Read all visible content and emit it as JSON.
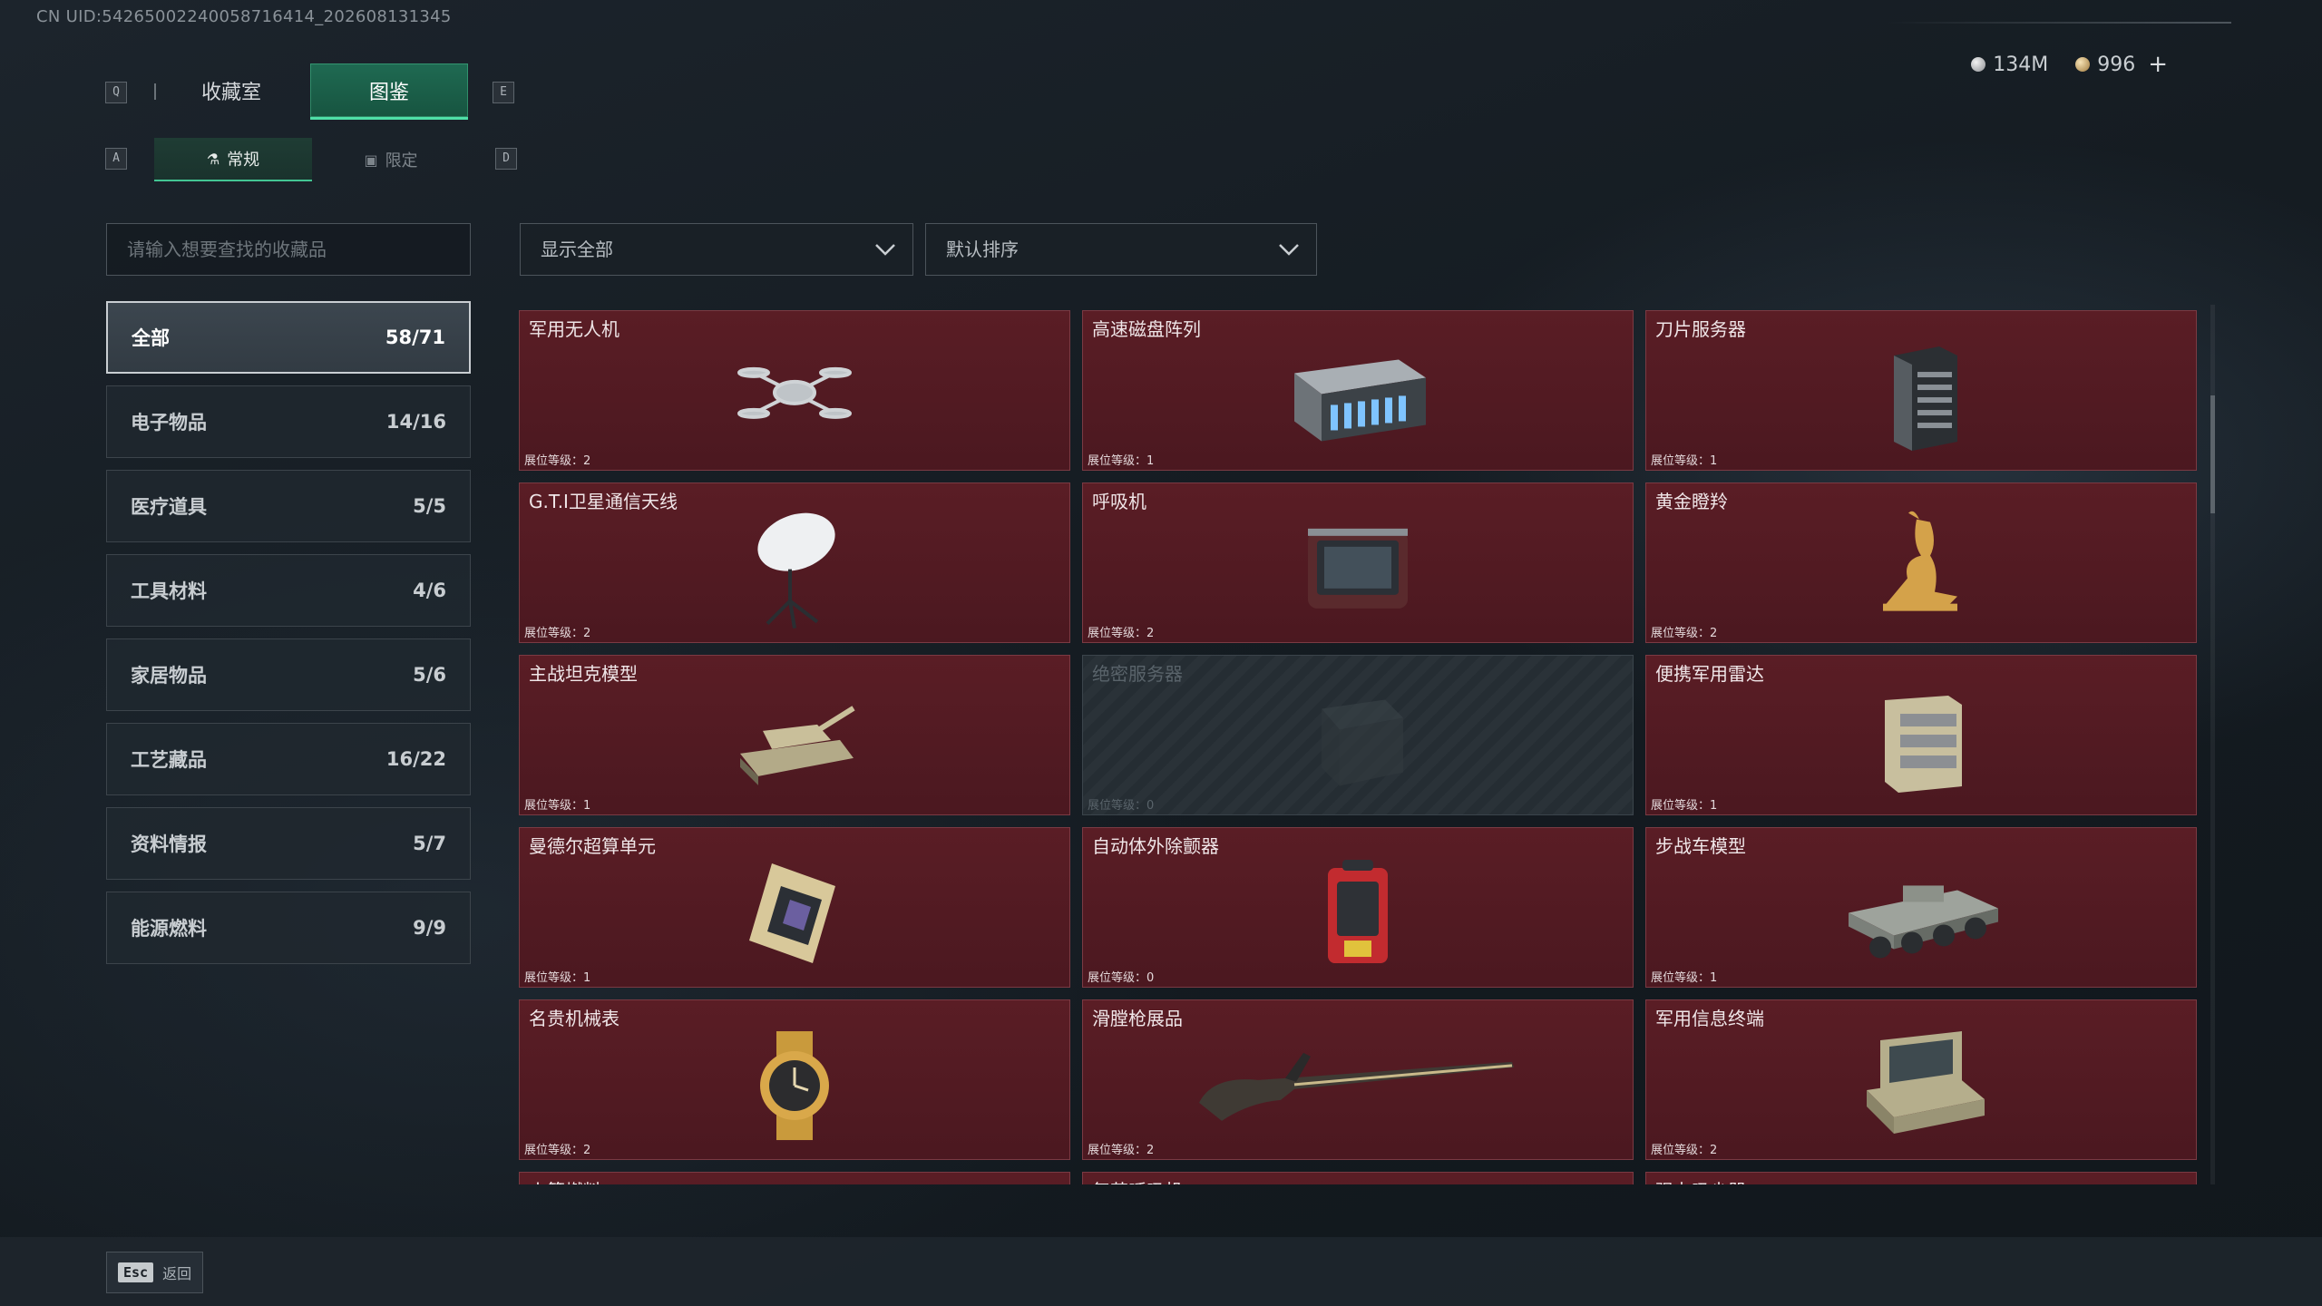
{
  "uid": "CN UID:5426500224005871641​4_202608131345",
  "tabs": {
    "prev_key": "Q",
    "next_key": "E",
    "items": [
      "收藏室",
      "图鉴"
    ],
    "active": 1
  },
  "sub_tabs": {
    "prev_key": "A",
    "next_key": "D",
    "items": [
      {
        "label": "常规",
        "icon": "flask-icon"
      },
      {
        "label": "限定",
        "icon": "image-icon"
      }
    ],
    "active": 0
  },
  "currency": {
    "silver": "134M",
    "gold": "996",
    "add": "+"
  },
  "search": {
    "placeholder": "请输入想要查找的收藏品"
  },
  "filters": {
    "show": "显示全部",
    "sort": "默认排序"
  },
  "categories": [
    {
      "label": "全部",
      "count": "58/71",
      "active": true
    },
    {
      "label": "电子物品",
      "count": "14/16"
    },
    {
      "label": "医疗道具",
      "count": "5/5"
    },
    {
      "label": "工具材料",
      "count": "4/6"
    },
    {
      "label": "家居物品",
      "count": "5/6"
    },
    {
      "label": "工艺藏品",
      "count": "16/22"
    },
    {
      "label": "资料情报",
      "count": "5/7"
    },
    {
      "label": "能源燃料",
      "count": "9/9"
    }
  ],
  "level_prefix": "展位等级：",
  "items": [
    {
      "name": "军用无人机",
      "level": "2",
      "icon": "drone-icon",
      "locked": false
    },
    {
      "name": "高速磁盘阵列",
      "level": "1",
      "icon": "disk-array-icon",
      "locked": false
    },
    {
      "name": "刀片服务器",
      "level": "1",
      "icon": "blade-server-icon",
      "locked": false
    },
    {
      "name": "G.T.I卫星通信天线",
      "level": "2",
      "icon": "satellite-dish-icon",
      "locked": false
    },
    {
      "name": "呼吸机",
      "level": "2",
      "icon": "ventilator-icon",
      "locked": false
    },
    {
      "name": "黄金瞪羚",
      "level": "2",
      "icon": "golden-gazelle-icon",
      "locked": false
    },
    {
      "name": "主战坦克模型",
      "level": "1",
      "icon": "tank-model-icon",
      "locked": false
    },
    {
      "name": "绝密服务器",
      "level": "0",
      "icon": "secret-server-icon",
      "locked": true
    },
    {
      "name": "便携军用雷达",
      "level": "1",
      "icon": "radar-icon",
      "locked": false
    },
    {
      "name": "曼德尔超算单元",
      "level": "1",
      "icon": "chip-icon",
      "locked": false
    },
    {
      "name": "自动体外除颤器",
      "level": "0",
      "icon": "defibrillator-icon",
      "locked": false
    },
    {
      "name": "步战车模型",
      "level": "1",
      "icon": "ifv-model-icon",
      "locked": false
    },
    {
      "name": "名贵机械表",
      "level": "2",
      "icon": "watch-icon",
      "locked": false
    },
    {
      "name": "滑膛枪展品",
      "level": "2",
      "icon": "musket-icon",
      "locked": false
    },
    {
      "name": "军用信息终端",
      "level": "2",
      "icon": "terminal-icon",
      "locked": false
    },
    {
      "name": "火箭燃料",
      "level": "",
      "icon": "rocket-fuel-icon",
      "locked": false
    },
    {
      "name": "复苏呼吸机",
      "level": "",
      "icon": "resus-ventilator-icon",
      "locked": false
    },
    {
      "name": "强力吸尘器",
      "level": "",
      "icon": "vacuum-icon",
      "locked": false
    }
  ],
  "bottom": {
    "esc_key": "Esc",
    "back_label": "返回"
  }
}
